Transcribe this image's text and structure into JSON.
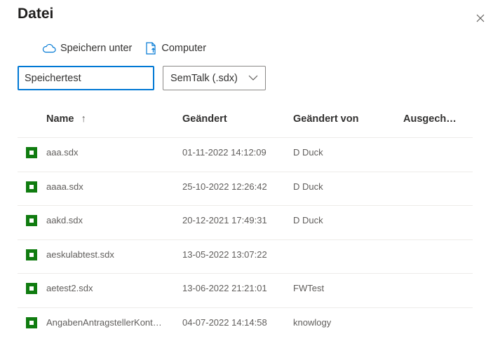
{
  "dialog": {
    "title": "Datei"
  },
  "commands": {
    "save_as": "Speichern unter",
    "computer": "Computer"
  },
  "filename": {
    "value": "Speichertest"
  },
  "filetype": {
    "selected": "SemTalk (.sdx)"
  },
  "columns": {
    "name": "Name",
    "sort_indicator": "↑",
    "modified": "Geändert",
    "modified_by": "Geändert von",
    "checked_out": "Ausgech…"
  },
  "files": [
    {
      "name": "aaa.sdx",
      "modified": "01-11-2022 14:12:09",
      "modified_by": "D Duck"
    },
    {
      "name": "aaaa.sdx",
      "modified": "25-10-2022 12:26:42",
      "modified_by": "D Duck"
    },
    {
      "name": "aakd.sdx",
      "modified": "20-12-2021 17:49:31",
      "modified_by": "D Duck"
    },
    {
      "name": "aeskulabtest.sdx",
      "modified": "13-05-2022 13:07:22",
      "modified_by": ""
    },
    {
      "name": "aetest2.sdx",
      "modified": "13-06-2022 21:21:01",
      "modified_by": "FWTest"
    },
    {
      "name": "AngabenAntragstellerKont…",
      "modified": "04-07-2022 14:14:58",
      "modified_by": "knowlogy"
    }
  ],
  "colors": {
    "accent": "#0078d4",
    "file_icon_green": "#107c10"
  },
  "icons": {
    "save_as": "cloud-icon",
    "computer": "upload-file-icon",
    "close": "close-icon",
    "dropdown": "chevron-down-icon",
    "file": "sdx-file-icon"
  }
}
